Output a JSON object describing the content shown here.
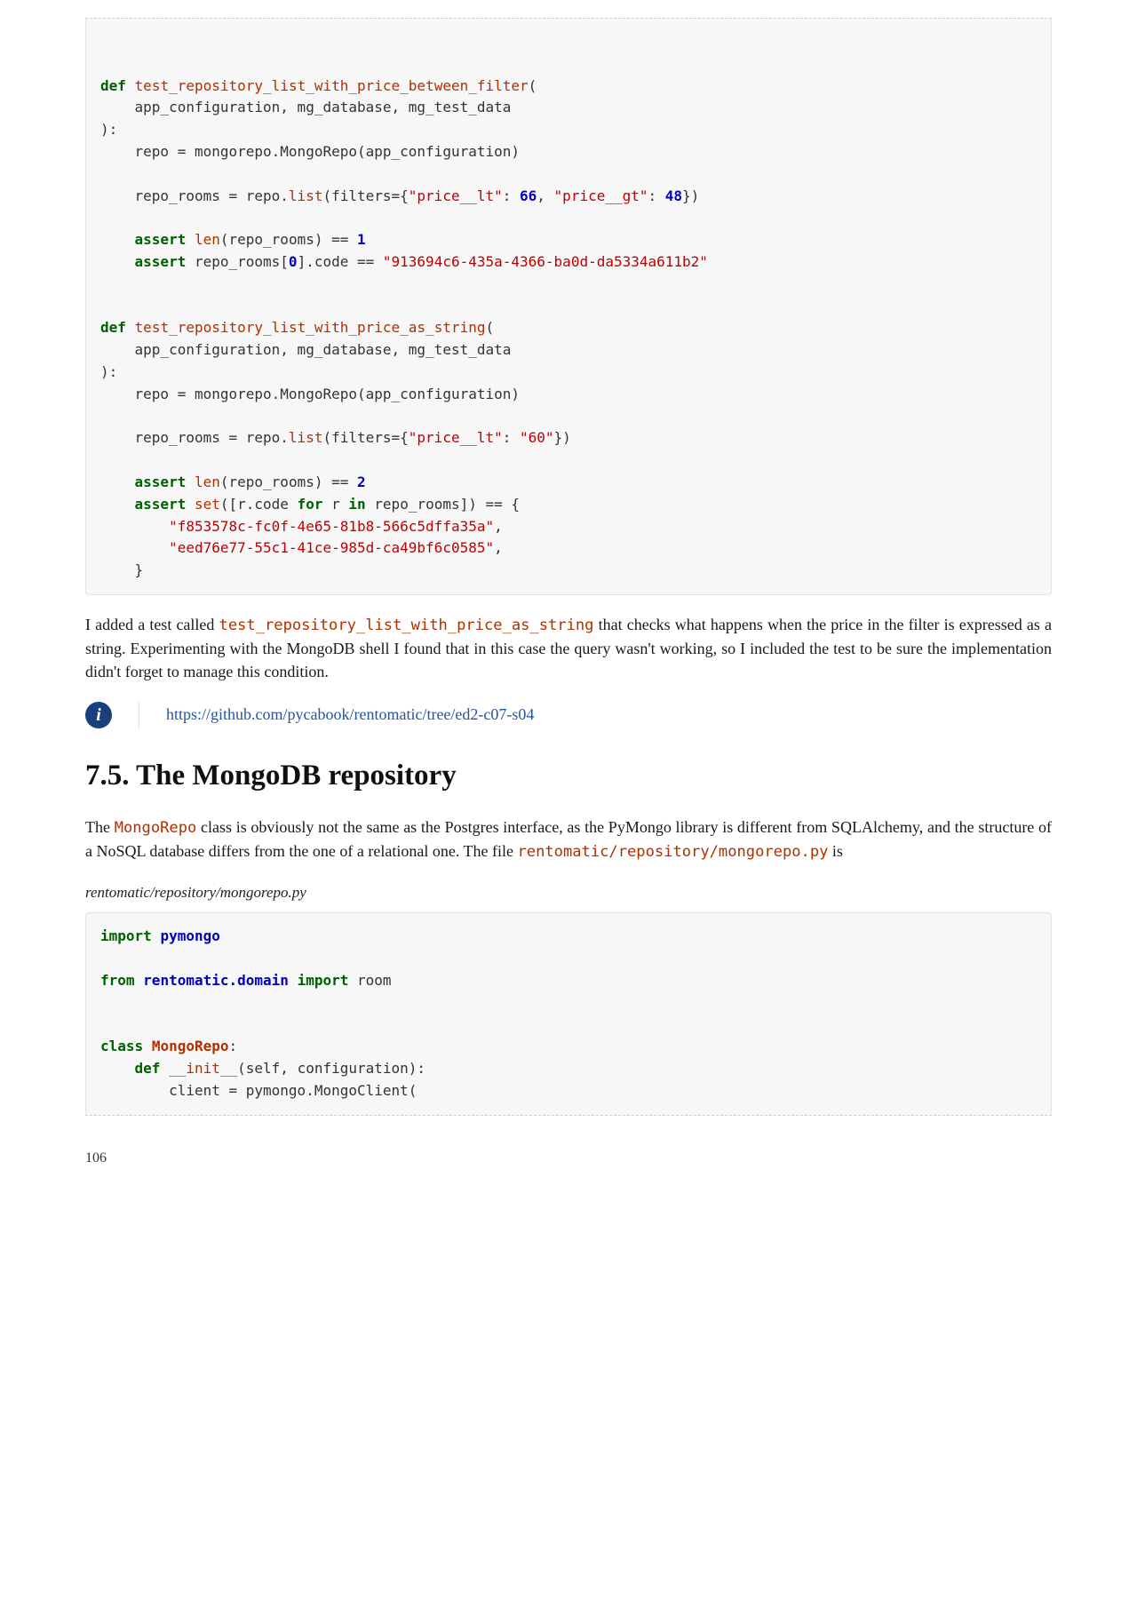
{
  "code1_html": "\n\n<span class=\"kw\">def</span> <span class=\"fn\">test_repository_list_with_price_between_filter</span>(\n    app_configuration, mg_database, mg_test_data\n):\n    repo = mongorepo.MongoRepo(app_configuration)\n\n    repo_rooms = repo.<span class=\"builtin\">list</span>(filters={<span class=\"lit\">\"price__lt\"</span>: <span class=\"num\">66</span>, <span class=\"lit\">\"price__gt\"</span>: <span class=\"num\">48</span>})\n\n    <span class=\"kw\">assert</span> <span class=\"builtin\">len</span>(repo_rooms) == <span class=\"num\">1</span>\n    <span class=\"kw\">assert</span> repo_rooms[<span class=\"idx\">0</span>].code == <span class=\"lit\">\"913694c6-435a-4366-ba0d-da5334a611b2\"</span>\n\n\n<span class=\"kw\">def</span> <span class=\"fn\">test_repository_list_with_price_as_string</span>(\n    app_configuration, mg_database, mg_test_data\n):\n    repo = mongorepo.MongoRepo(app_configuration)\n\n    repo_rooms = repo.<span class=\"builtin\">list</span>(filters={<span class=\"lit\">\"price__lt\"</span>: <span class=\"lit\">\"60\"</span>})\n\n    <span class=\"kw\">assert</span> <span class=\"builtin\">len</span>(repo_rooms) == <span class=\"num\">2</span>\n    <span class=\"kw\">assert</span> <span class=\"builtin\">set</span>([r.code <span class=\"kw\">for</span> r <span class=\"kw\">in</span> repo_rooms]) == {\n        <span class=\"lit\">\"f853578c-fc0f-4e65-81b8-566c5dffa35a\"</span>,\n        <span class=\"lit\">\"eed76e77-55c1-41ce-985d-ca49bf6c0585\"</span>,\n    }",
  "para1_pre": "I added a test called ",
  "para1_code": "test_repository_list_with_price_as_string",
  "para1_post": " that checks what happens when the price in the filter is expressed as a string. Experimenting with the MongoDB shell I found that in this case the query wasn't working, so I included the test to be sure the implementation didn't forget to manage this condition.",
  "info_icon_text": "i",
  "github_link": "https://github.com/pycabook/rentomatic/tree/ed2-c07-s04",
  "section_title": "7.5. The MongoDB repository",
  "para2_pre": "The ",
  "para2_code1": "MongoRepo",
  "para2_mid": " class is obviously not the same as the Postgres interface, as the PyMongo library is different from SQLAlchemy, and the structure of a NoSQL database differs from the one of a relational one. The file ",
  "para2_code2": "rentomatic/repository/mongorepo.py",
  "para2_end": " is",
  "filepath": "rentomatic/repository/mongorepo.py",
  "code2_html": "<span class=\"kw\">import</span> <span class=\"mod\">pymongo</span>\n\n<span class=\"kw\">from</span> <span class=\"mod\">rentomatic.domain</span> <span class=\"kw\">import</span> room\n\n\n<span class=\"kw\">class</span> <span class=\"cls\">MongoRepo</span>:\n    <span class=\"kw\">def</span> <span class=\"fn\">__init__</span>(self, configuration):\n        client = pymongo.MongoClient(",
  "page_number": "106"
}
